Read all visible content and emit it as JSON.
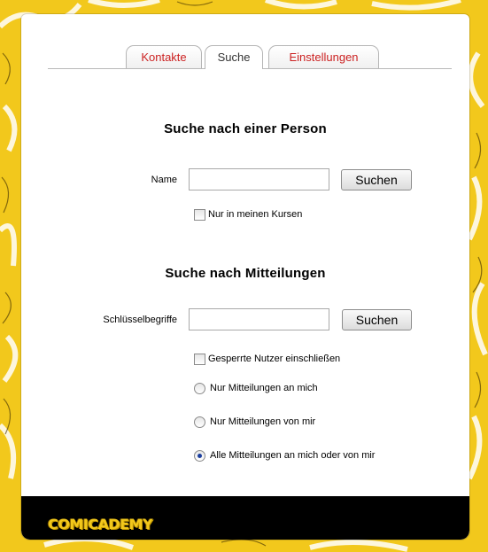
{
  "tabs": {
    "kontakte": "Kontakte",
    "suche": "Suche",
    "einstellungen": "Einstellungen"
  },
  "person_search": {
    "heading": "Suche nach einer Person",
    "name_label": "Name",
    "name_value": "",
    "button": "Suchen",
    "only_my_courses": "Nur in meinen Kursen"
  },
  "message_search": {
    "heading": "Suche nach Mitteilungen",
    "keywords_label": "Schlüsselbegriffe",
    "keywords_value": "",
    "button": "Suchen",
    "include_blocked": "Gesperrte Nutzer einschließen",
    "radio_options": [
      {
        "label": "Nur Mitteilungen an mich",
        "checked": false
      },
      {
        "label": "Nur Mitteilungen von mir",
        "checked": false
      },
      {
        "label": "Alle Mitteilungen an mich oder von mir",
        "checked": true
      }
    ]
  },
  "footer": {
    "logo": "COMICADEMY"
  },
  "colors": {
    "background": "#f2c81c",
    "tab_link": "#cc2222",
    "footer": "#000000"
  }
}
